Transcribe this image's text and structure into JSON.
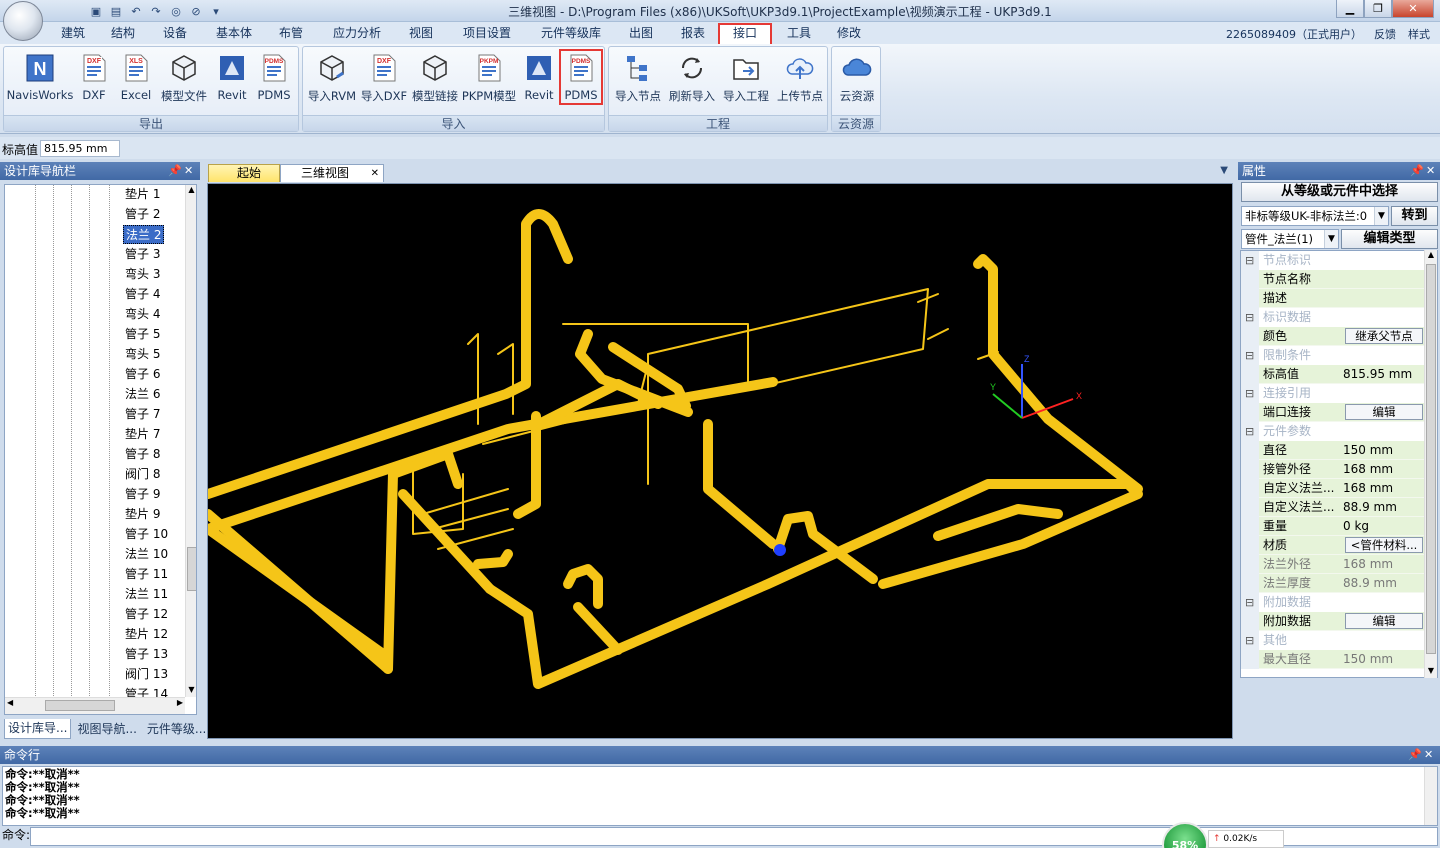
{
  "window": {
    "title": "三维视图 - D:\\Program Files (x86)\\UKSoft\\UKP3d9.1\\ProjectExample\\视频演示工程 - UKP3d9.1"
  },
  "menu": [
    "建筑",
    "结构",
    "设备",
    "基本体",
    "布管",
    "应力分析",
    "视图",
    "项目设置",
    "元件等级库",
    "出图",
    "报表",
    "接口",
    "工具",
    "修改"
  ],
  "menu_active": "接口",
  "user": {
    "id": "2265089409（正式用户）",
    "feedback": "反馈",
    "style": "样式"
  },
  "ribbon": {
    "export": {
      "label": "导出",
      "buttons": [
        "NavisWorks",
        "DXF",
        "Excel",
        "模型文件",
        "Revit",
        "PDMS"
      ]
    },
    "import": {
      "label": "导入",
      "buttons": [
        "导入RVM",
        "导入DXF",
        "模型链接",
        "PKPM模型",
        "Revit",
        "PDMS"
      ]
    },
    "project": {
      "label": "工程",
      "buttons": [
        "导入节点",
        "刷新导入",
        "导入工程",
        "上传节点"
      ]
    },
    "cloud": {
      "label": "云资源",
      "buttons": [
        "云资源"
      ]
    }
  },
  "icon_text": {
    "dxf": "DXF",
    "xls": "XLS",
    "pdms": "PDMS",
    "pkpm": "PKPM",
    "n": "N"
  },
  "elevation": {
    "label": "标高值",
    "value": "815.95 mm"
  },
  "left_panel": {
    "title": "设计库导航栏",
    "items": [
      "垫片 1",
      "管子 2",
      "法兰 2",
      "管子 3",
      "弯头 3",
      "管子 4",
      "弯头 4",
      "管子 5",
      "弯头 5",
      "管子 6",
      "法兰 6",
      "管子 7",
      "垫片 7",
      "管子 8",
      "阀门 8",
      "管子 9",
      "垫片 9",
      "管子 10",
      "法兰 10",
      "管子 11",
      "法兰 11",
      "管子 12",
      "垫片 12",
      "管子 13",
      "阀门 13",
      "管子 14"
    ],
    "selected_index": 2,
    "tabs": [
      "设计库导...",
      "视图导航...",
      "元件等级..."
    ]
  },
  "doc_tabs": [
    "起始页",
    "三维视图"
  ],
  "axes": {
    "z": "Z",
    "x": "X",
    "y": "Y"
  },
  "right_panel": {
    "title": "属性",
    "select_button": "从等级或元件中选择",
    "grade_dropdown": "非标等级UK-非标法兰:0",
    "goto_button": "转到",
    "component_dropdown": "管件_法兰(1)",
    "edit_type_button": "编辑类型",
    "rows": [
      {
        "type": "cat",
        "name": "节点标识"
      },
      {
        "type": "item",
        "name": "节点名称",
        "value": ""
      },
      {
        "type": "item",
        "name": "描述",
        "value": ""
      },
      {
        "type": "cat",
        "name": "标识数据"
      },
      {
        "type": "item",
        "name": "颜色",
        "value": "继承父节点",
        "button": true
      },
      {
        "type": "cat",
        "name": "限制条件"
      },
      {
        "type": "item",
        "name": "标高值",
        "value": "815.95 mm"
      },
      {
        "type": "cat",
        "name": "连接引用"
      },
      {
        "type": "item",
        "name": "端口连接",
        "value": "编辑",
        "button": true
      },
      {
        "type": "cat",
        "name": "元件参数"
      },
      {
        "type": "item",
        "name": "直径",
        "value": "150 mm"
      },
      {
        "type": "item",
        "name": "接管外径",
        "value": "168 mm"
      },
      {
        "type": "item",
        "name": "自定义法兰...",
        "value": "168 mm"
      },
      {
        "type": "item",
        "name": "自定义法兰...",
        "value": "88.9 mm"
      },
      {
        "type": "item",
        "name": "重量",
        "value": "0 kg"
      },
      {
        "type": "item",
        "name": "材质",
        "value": "<管件材料...",
        "button": true
      },
      {
        "type": "item",
        "name": "法兰外径",
        "value": "168 mm",
        "dim": true
      },
      {
        "type": "item",
        "name": "法兰厚度",
        "value": "88.9 mm",
        "dim": true
      },
      {
        "type": "cat",
        "name": "附加数据"
      },
      {
        "type": "item",
        "name": "附加数据",
        "value": "编辑",
        "button": true
      },
      {
        "type": "cat",
        "name": "其他"
      },
      {
        "type": "item",
        "name": "最大直径",
        "value": "150 mm",
        "dim": true
      }
    ]
  },
  "command": {
    "title": "命令行",
    "lines": [
      "命令:**取消**",
      "命令:**取消**",
      "命令:**取消**",
      "命令:**取消**"
    ],
    "prompt": "命令:"
  },
  "net": {
    "percent": "58%",
    "speed": "0.02K/s"
  },
  "colors": {
    "pipe": "#f5c518",
    "accent_red": "#e53935",
    "panel_head": "#4a70a8"
  }
}
